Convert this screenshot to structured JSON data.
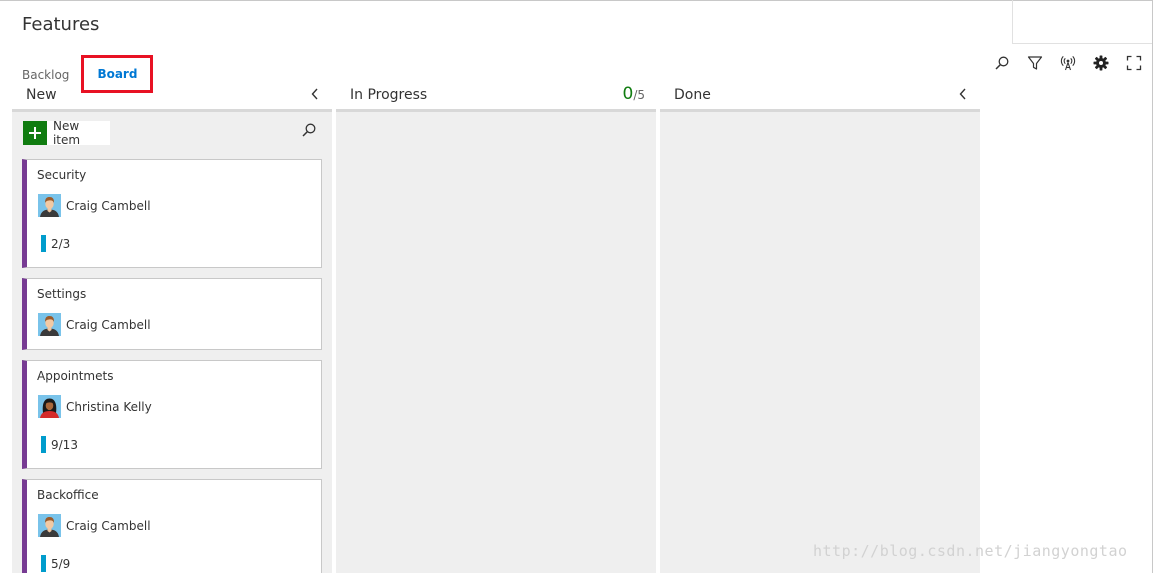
{
  "page": {
    "title": "Features"
  },
  "tabs": [
    {
      "label": "Backlog",
      "active": false
    },
    {
      "label": "Board",
      "active": true
    }
  ],
  "toolbar": {
    "icons": [
      "search-icon",
      "filter-icon",
      "live-updates-icon",
      "settings-icon",
      "fullscreen-icon"
    ]
  },
  "columns": [
    {
      "name": "New"
    },
    {
      "name": "In Progress",
      "wip_count": "0",
      "wip_limit": "/5"
    },
    {
      "name": "Done"
    }
  ],
  "new_item": {
    "label": "New item"
  },
  "cards": [
    {
      "title": "Security",
      "assignee": "Craig Cambell",
      "avatar": "male",
      "progress": "2/3"
    },
    {
      "title": "Settings",
      "assignee": "Craig Cambell",
      "avatar": "male",
      "progress": ""
    },
    {
      "title": "Appointmets",
      "assignee": "Christina Kelly",
      "avatar": "female",
      "progress": "9/13"
    },
    {
      "title": "Backoffice",
      "assignee": "Craig Cambell",
      "avatar": "male",
      "progress": "5/9"
    }
  ],
  "watermark": "http://blog.csdn.net/jiangyongtao",
  "colors": {
    "accent": "#0078d4",
    "highlight_box": "#e81123",
    "card_stripe": "#773b93",
    "progress_bar": "#009ccc",
    "wip_ok": "#107c10",
    "add_button": "#107c10"
  }
}
